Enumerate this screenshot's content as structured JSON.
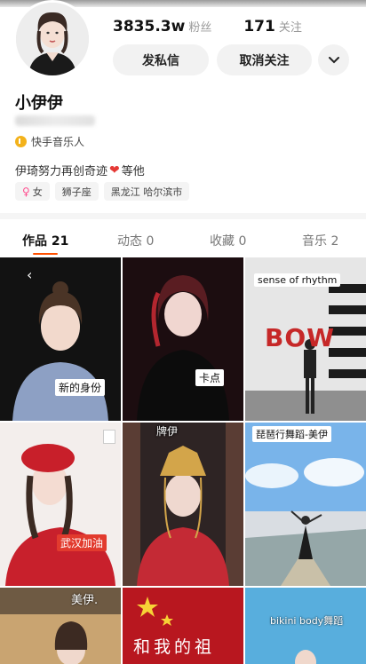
{
  "profile": {
    "name": "小伊伊",
    "followers_value": "3835.3w",
    "followers_label": "粉丝",
    "following_value": "171",
    "following_label": "关注",
    "badge": "快手音乐人",
    "bio_before": "伊琦努力再创奇迹",
    "bio_after": "等他",
    "tags": [
      {
        "label": "女",
        "icon": "female-icon"
      },
      {
        "label": "狮子座"
      },
      {
        "label": "黑龙江 哈尔滨市"
      }
    ]
  },
  "actions": {
    "message_label": "发私信",
    "unfollow_label": "取消关注",
    "more_icon": "chevron-down-icon"
  },
  "tabs": [
    {
      "label": "作品 21",
      "active": true
    },
    {
      "label": "动态 0",
      "active": false
    },
    {
      "label": "收藏 0",
      "active": false
    },
    {
      "label": "音乐 2",
      "active": false
    }
  ],
  "videos": [
    {
      "caption": "新的身份"
    },
    {
      "caption": "卡点"
    },
    {
      "caption": "sense of rhythm",
      "overlay": "BOW"
    },
    {
      "caption": "武汉加油"
    },
    {
      "caption": "牌伊"
    },
    {
      "caption": "琵琶行舞蹈-美伊"
    },
    {
      "caption": "美伊."
    },
    {
      "caption": "和我的祖"
    },
    {
      "caption": "bikini body舞蹈"
    }
  ],
  "colors": {
    "accent": "#ff5000",
    "heart": "#e53935",
    "badge": "#f3b21b"
  }
}
